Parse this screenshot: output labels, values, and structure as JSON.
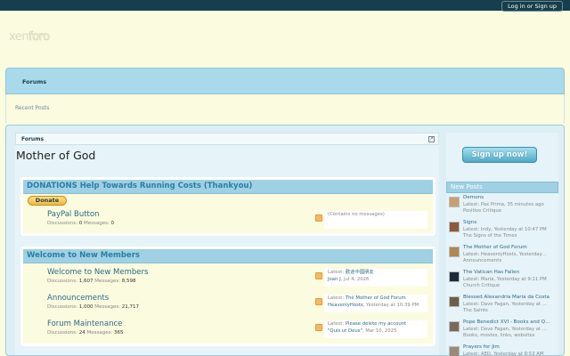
{
  "header": {
    "login_label": "Log in or Sign up",
    "logo_part1": "xen",
    "logo_part2": "foro"
  },
  "nav": {
    "tab_forums": "Forums",
    "sub_recent_posts": "Recent Posts"
  },
  "breadcrumb": {
    "label": "Forums",
    "jump_icon": "arrow-up-right-icon"
  },
  "page_title": "Mother of God",
  "categories": [
    {
      "title": "DONATIONS Help Towards Running Costs (Thankyou)",
      "donate_label": "Donate",
      "nodes": [
        {
          "title": "PayPal Button",
          "discussions_label": "Discussions:",
          "discussions": "0",
          "messages_label": "Messages:",
          "messages": "0",
          "last_empty": "(Contains no messages)"
        }
      ]
    },
    {
      "title": "Welcome to New Members",
      "nodes": [
        {
          "title": "Welcome to New Members",
          "discussions_label": "Discussions:",
          "discussions": "1,607",
          "messages_label": "Messages:",
          "messages": "8,598",
          "latest_label": "Latest:",
          "latest_title": "歡迎中國朋友",
          "latest_user": "Joan J",
          "latest_date": ", Jul 4, 2026"
        },
        {
          "title": "Announcements",
          "discussions_label": "Discussions:",
          "discussions": "1,000",
          "messages_label": "Messages:",
          "messages": "21,717",
          "latest_label": "Latest:",
          "latest_title": "The Mother of God Forum",
          "latest_user": "HeavenlyHosts",
          "latest_date": ", Yesterday at 10:39 PM"
        },
        {
          "title": "Forum Maintenance",
          "discussions_label": "Discussions:",
          "discussions": "24",
          "messages_label": "Messages:",
          "messages": "365",
          "latest_label": "Latest:",
          "latest_title": "Please delete my account",
          "latest_user": "\"Quis ut Deus\"",
          "latest_date": ", Mar 10, 2025"
        }
      ]
    }
  ],
  "sidebar": {
    "signup_label": "Sign up now!",
    "new_posts_title": "New Posts",
    "posts": [
      {
        "title": "Demons",
        "latest": "Latest: Pax Prima, 35 minutes ago",
        "forum": "Positive Critique",
        "avatar_color": "#c8a070"
      },
      {
        "title": "Signs",
        "latest": "Latest: Indy, Yesterday at 10:47 PM",
        "forum": "The Signs of the Times",
        "avatar_color": "#8a5a3a"
      },
      {
        "title": "The Mother of God Forum",
        "latest": "Latest: HeavenlyHosts, Yesterday...",
        "forum": "Announcements",
        "avatar_color": "#b08850"
      },
      {
        "title": "The Vatican Has Fallen",
        "latest": "Latest: Maria, Yesterday at 9:11 PM",
        "forum": "Church Critique",
        "avatar_color": "#1a2a3a"
      },
      {
        "title": "Blessed Alexandria Maria da Costa",
        "latest": "Latest: Dave Fagan, Yesterday at ...",
        "forum": "The Saints",
        "avatar_color": "#6a6048"
      },
      {
        "title": "Pope Benedict XVI - Books and Q...",
        "latest": "Latest: Dave Fagan, Yesterday at ...",
        "forum": "Books, movies, links, websites",
        "avatar_color": "#7a6a58"
      },
      {
        "title": "Prayers for Jim",
        "latest": "Latest: AED, Yesterday at 8:53 AM",
        "forum": "",
        "avatar_color": "#9a8a7a"
      }
    ]
  }
}
